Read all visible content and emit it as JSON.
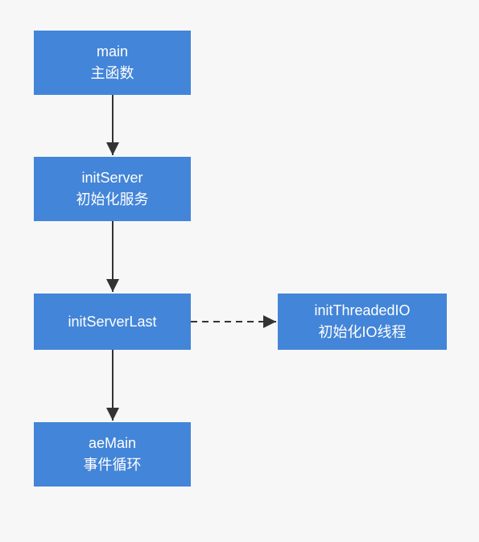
{
  "diagram": {
    "nodes": {
      "main": {
        "line1": "main",
        "line2": "主函数"
      },
      "initServer": {
        "line1": "initServer",
        "line2": "初始化服务"
      },
      "initServerLast": {
        "line1": "initServerLast"
      },
      "aeMain": {
        "line1": "aeMain",
        "line2": "事件循环"
      },
      "initThreadedIO": {
        "line1": "initThreadedIO",
        "line2": "初始化IO线程"
      }
    },
    "edges": [
      {
        "from": "main",
        "to": "initServer",
        "style": "solid"
      },
      {
        "from": "initServer",
        "to": "initServerLast",
        "style": "solid"
      },
      {
        "from": "initServerLast",
        "to": "aeMain",
        "style": "solid"
      },
      {
        "from": "initServerLast",
        "to": "initThreadedIO",
        "style": "dashed"
      }
    ]
  },
  "chart_data": {
    "type": "diagram",
    "nodes": [
      {
        "id": "main",
        "label": "main 主函数"
      },
      {
        "id": "initServer",
        "label": "initServer 初始化服务"
      },
      {
        "id": "initServerLast",
        "label": "initServerLast"
      },
      {
        "id": "aeMain",
        "label": "aeMain 事件循环"
      },
      {
        "id": "initThreadedIO",
        "label": "initThreadedIO 初始化IO线程"
      }
    ],
    "edges": [
      {
        "from": "main",
        "to": "initServer",
        "style": "solid"
      },
      {
        "from": "initServer",
        "to": "initServerLast",
        "style": "solid"
      },
      {
        "from": "initServerLast",
        "to": "aeMain",
        "style": "solid"
      },
      {
        "from": "initServerLast",
        "to": "initThreadedIO",
        "style": "dashed"
      }
    ]
  }
}
